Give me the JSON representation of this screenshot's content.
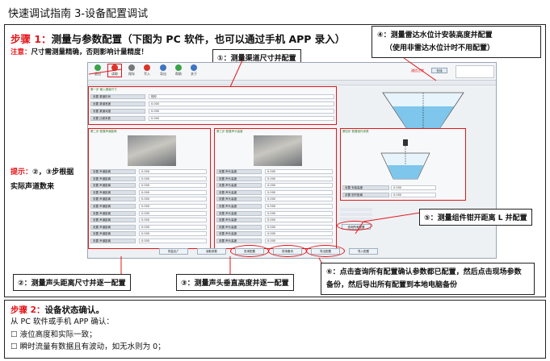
{
  "doc": {
    "title": "快速调试指南 3-设备配置调试",
    "step1_label": "步骤 1：",
    "step1_text": "测量与参数配置（下图为 PC 软件，也可以通过手机 APP 录入）",
    "note_label": "注意：",
    "note_text": "尺寸需测量精确，否则影响计量精度！",
    "side_hint_red": "提示：",
    "side_hint_line1": "②，③步根据",
    "side_hint_line2": "实际声道数来",
    "step2_label": "步骤 2：",
    "step2_text": "设备状态确认。",
    "confirm_intro": "从 PC 软件或手机 APP 确认：",
    "check1": "液位高度和实际一致；",
    "check2": "瞬时流量有数据且有波动，如无水则为 0；",
    "checkbox": "☐"
  },
  "callouts": {
    "c1": "①：测量渠道尺寸并配置",
    "c2": "②：测量声头距离尺寸并逐一配置",
    "c3": "③：测量声头垂直高度并逐一配置",
    "c4_line1": "④：测量雷达水位计安装高度并配置",
    "c4_line2": "（使用非雷达水位计时不用配置）",
    "c5": "⑤：测量组件钳开距离 L 并配置",
    "c6_line1": "⑥：点击查询所有配置确认参数都已配置，然后点击现场参数",
    "c6_line2": "备份，然后导出所有配置到本地电脑备份"
  },
  "app": {
    "toolbar": [
      "退出",
      "读取",
      "保存",
      "写入",
      "导出",
      "帮助",
      "关于"
    ],
    "panel1_title": "第一步 输入渠道尺寸",
    "panel1_rows": [
      {
        "label": "设置 渠道形状",
        "value": "梯形"
      },
      {
        "label": "设置 渠道宽度",
        "value": "0.000"
      },
      {
        "label": "设置 渠道深度",
        "value": "0.000"
      },
      {
        "label": "设置 边坡系数",
        "value": "0.000"
      }
    ],
    "panel2_title": "第二步 配置声道距离",
    "panel3_title": "第三步 配置声头高度",
    "panel2_label": "设置 声道距离",
    "panel3_label": "设置 声头高度",
    "field_value": "0.000",
    "panel5_title": "第四步 配置组件参数",
    "panel5_rows": [
      {
        "label": "设置 安装高度",
        "value": "0.000"
      },
      {
        "label": "设置 钳开距离",
        "value": "0.000"
      }
    ],
    "query_btn": "查询所有配置",
    "bottom_buttons": [
      "恢复出厂",
      "读取参数",
      "查询配置",
      "现场备份",
      "导出配置",
      "导入配置"
    ],
    "status_items": [
      "通信正常",
      "在线"
    ]
  }
}
